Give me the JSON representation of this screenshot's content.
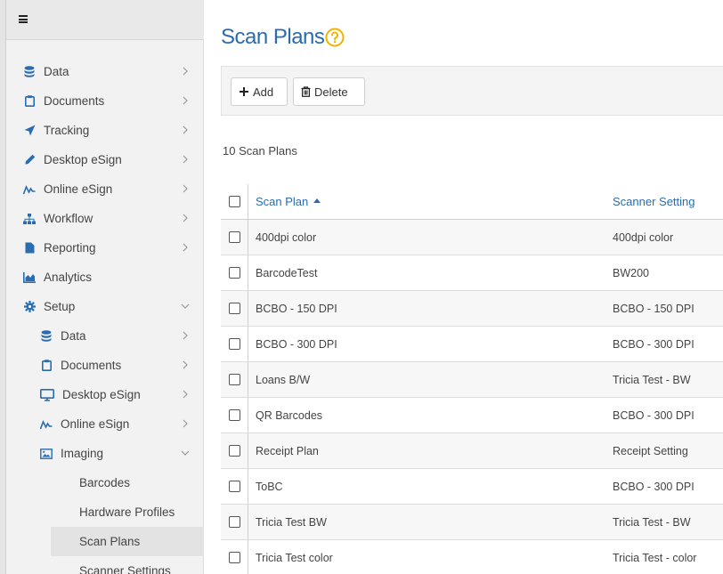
{
  "sidebar": {
    "items": [
      {
        "label": "Data",
        "icon": "database-icon",
        "chevron": "right"
      },
      {
        "label": "Documents",
        "icon": "clipboard-icon",
        "chevron": "right"
      },
      {
        "label": "Tracking",
        "icon": "paper-plane-icon",
        "chevron": "right"
      },
      {
        "label": "Desktop eSign",
        "icon": "pen-icon",
        "chevron": "right"
      },
      {
        "label": "Online eSign",
        "icon": "signature-icon",
        "chevron": "right"
      },
      {
        "label": "Workflow",
        "icon": "sitemap-icon",
        "chevron": "right"
      },
      {
        "label": "Reporting",
        "icon": "file-icon",
        "chevron": "right"
      },
      {
        "label": "Analytics",
        "icon": "chart-icon",
        "chevron": "none"
      },
      {
        "label": "Setup",
        "icon": "gear-icon",
        "chevron": "down"
      }
    ],
    "setup_items": [
      {
        "label": "Data",
        "icon": "database-icon"
      },
      {
        "label": "Documents",
        "icon": "clipboard-icon"
      },
      {
        "label": "Desktop eSign",
        "icon": "monitor-icon"
      },
      {
        "label": "Online eSign",
        "icon": "signature-icon"
      },
      {
        "label": "Imaging",
        "icon": "image-icon"
      }
    ],
    "imaging_items": [
      {
        "label": "Barcodes"
      },
      {
        "label": "Hardware Profiles"
      },
      {
        "label": "Scan Plans",
        "active": true
      },
      {
        "label": "Scanner Settings"
      }
    ]
  },
  "main": {
    "title": "Scan Plans",
    "toolbar": {
      "add_label": "Add",
      "delete_label": "Delete"
    },
    "count_text": "10 Scan Plans",
    "table": {
      "columns": [
        "Scan Plan",
        "Scanner Setting"
      ],
      "rows": [
        [
          "400dpi color",
          "400dpi color"
        ],
        [
          "BarcodeTest",
          "BW200"
        ],
        [
          "BCBO - 150 DPI",
          "BCBO - 150 DPI"
        ],
        [
          "BCBO - 300 DPI",
          "BCBO - 300 DPI"
        ],
        [
          "Loans B/W",
          "Tricia Test - BW"
        ],
        [
          "QR Barcodes",
          "BCBO - 300 DPI"
        ],
        [
          "Receipt Plan",
          "Receipt Setting"
        ],
        [
          "ToBC",
          "BCBO - 300 DPI"
        ],
        [
          "Tricia Test BW",
          "Tricia Test - BW"
        ],
        [
          "Tricia Test color",
          "Tricia Test - color"
        ]
      ]
    }
  },
  "colors": {
    "accent": "#2a6cb0",
    "help": "#f0b400",
    "nav_icon": "#2a6cb0"
  }
}
